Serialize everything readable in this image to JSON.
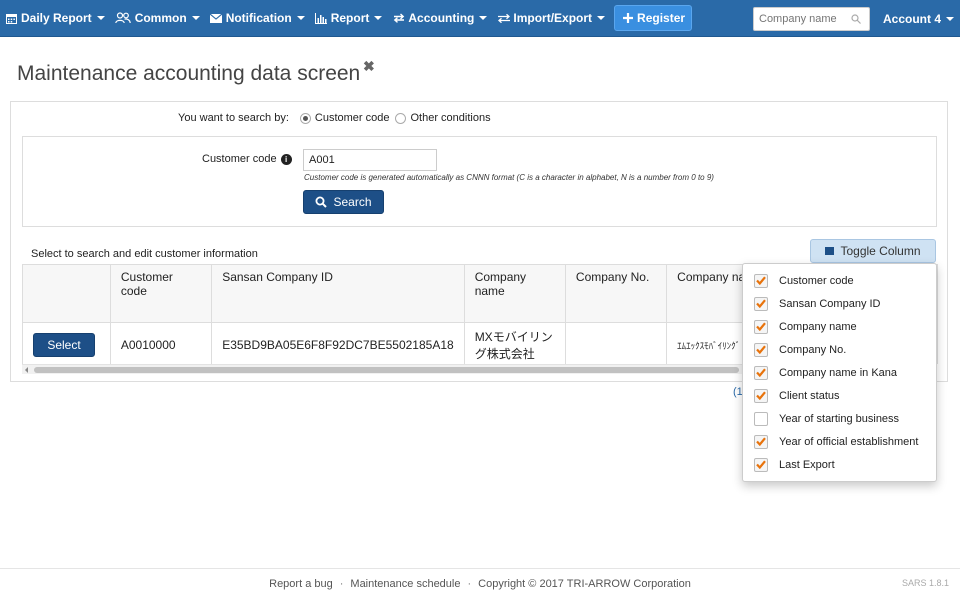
{
  "navbar": {
    "items": [
      {
        "label": "Daily Report",
        "icon": "calendar-icon"
      },
      {
        "label": "Common",
        "icon": "users-icon"
      },
      {
        "label": "Notification",
        "icon": "envelope-icon"
      },
      {
        "label": "Report",
        "icon": "bar-chart-icon"
      },
      {
        "label": "Accounting",
        "icon": "exchange-icon"
      },
      {
        "label": "Import/Export",
        "icon": "arrows-icon"
      }
    ],
    "register_label": "Register",
    "search_placeholder": "Company name",
    "account_label": "Account 4"
  },
  "page": {
    "title": "Maintenance accounting data screen",
    "close_symbol": "✖"
  },
  "search_form": {
    "search_by_label": "You want to search by:",
    "options": [
      {
        "label": "Customer code",
        "checked": true
      },
      {
        "label": "Other conditions",
        "checked": false
      }
    ],
    "customer_code_label": "Customer code",
    "customer_code_value": "A001",
    "hint": "Customer code is generated automatically as CNNN format (C is a character in alphabet, N is a number from 0 to 9)",
    "search_button": "Search"
  },
  "results": {
    "hint": "Select to search and edit customer information",
    "toggle_column_label": "Toggle Column",
    "columns": [
      "",
      "Customer code",
      "Sansan Company ID",
      "Company name",
      "Company No.",
      "Company name in Kana"
    ],
    "rows": [
      {
        "action": "Select",
        "customer_code": "A0010000",
        "sansan_id": "E35BD9BA05E6F8F92DC7BE5502185A18",
        "company_name": "MXモバイリング株式会社",
        "company_no": "",
        "company_kana": "ｴﾑｴｯｸｽﾓﾊﾞｲﾘﾝｸﾞ"
      }
    ],
    "pager_fragment": "(1"
  },
  "toggle_menu": {
    "items": [
      {
        "label": "Customer code",
        "checked": true
      },
      {
        "label": "Sansan Company ID",
        "checked": true
      },
      {
        "label": "Company name",
        "checked": true
      },
      {
        "label": "Company No.",
        "checked": true
      },
      {
        "label": "Company name in Kana",
        "checked": true
      },
      {
        "label": "Client status",
        "checked": true
      },
      {
        "label": "Year of starting business",
        "checked": false
      },
      {
        "label": "Year of official establishment",
        "checked": true
      },
      {
        "label": "Last Export",
        "checked": true
      }
    ]
  },
  "footer": {
    "links": [
      "Report a bug",
      "Maintenance schedule"
    ],
    "copyright": "Copyright © 2017 TRI-ARROW Corporation",
    "separator": "·",
    "version": "SARS 1.8.1"
  },
  "colors": {
    "navbar": "#2a6aa8",
    "primary_button": "#1d4f87",
    "checkbox_accent": "#e8730c"
  }
}
